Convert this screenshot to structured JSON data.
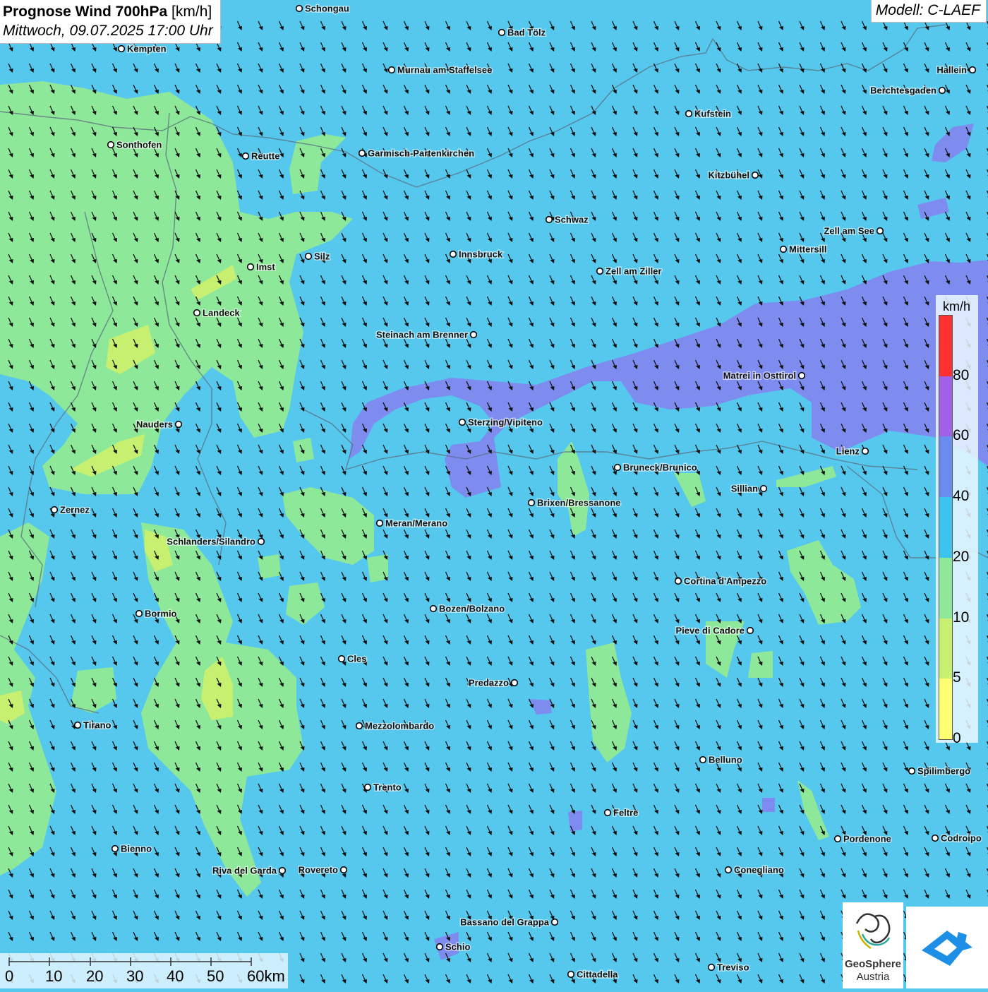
{
  "title": {
    "bold": "Prognose Wind 700hPa",
    "unit": "[km/h]",
    "datetime": "Mittwoch, 09.07.2025 17:00 Uhr"
  },
  "model_label": "Modell: C-LAEF",
  "legend": {
    "unit": "km/h",
    "ticks": [
      "80",
      "60",
      "40",
      "20",
      "10",
      "5",
      "0"
    ],
    "colors": [
      "#ff3030",
      "#a060e8",
      "#6a8cf0",
      "#3cc4ee",
      "#8ee89a",
      "#c8f070",
      "#ffff70"
    ]
  },
  "scale_bar": {
    "labels": [
      "0",
      "10",
      "20",
      "30",
      "40",
      "50",
      "60km"
    ]
  },
  "logos": {
    "left_line1": "GeoSphere",
    "left_line2": "Austria",
    "left_icon": "geosphere-logo-icon",
    "right_icon": "weather-app-logo-icon"
  },
  "colors": {
    "background_wind_20_40": "#56c8ee",
    "wind_10_20": "#8ee89a",
    "wind_5_10": "#c8f070",
    "wind_40_60": "#7e8cf0",
    "arrow": "#111111",
    "city_marker": "#ffffff"
  },
  "cities": [
    "Schongau",
    "Bad Tölz",
    "Kempten",
    "Murnau am Staffelsee",
    "Hallein",
    "Berchtesgaden",
    "Kufstein",
    "Sonthofen",
    "Reutte",
    "Garmisch-Partenkirchen",
    "Kitzbühel",
    "Schwaz",
    "Zell am See",
    "Mittersill",
    "Innsbruck",
    "Zell am Ziller",
    "Imst",
    "Silz",
    "Landeck",
    "Steinach am Brenner",
    "Matrei in Osttirol",
    "Nauders",
    "Sterzing/Vipiteno",
    "Lienz",
    "Bruneck/Brunico",
    "Sillian",
    "Brixen/Bressanone",
    "Zernez",
    "Meran/Merano",
    "Schlanders/Silandro",
    "Cortina d'Ampezzo",
    "Bozen/Bolzano",
    "Bormio",
    "Pieve di Cadore",
    "Cles",
    "Predazzo",
    "Tirano",
    "Mezzolombardo",
    "Belluno",
    "Spilimbergo",
    "Trento",
    "Feltre",
    "Pordenone",
    "Codroipo",
    "Bienno",
    "Riva del Garda",
    "Rovereto",
    "Conegliano",
    "Bassano del Grappa",
    "Schio",
    "Treviso",
    "Cittadella"
  ]
}
